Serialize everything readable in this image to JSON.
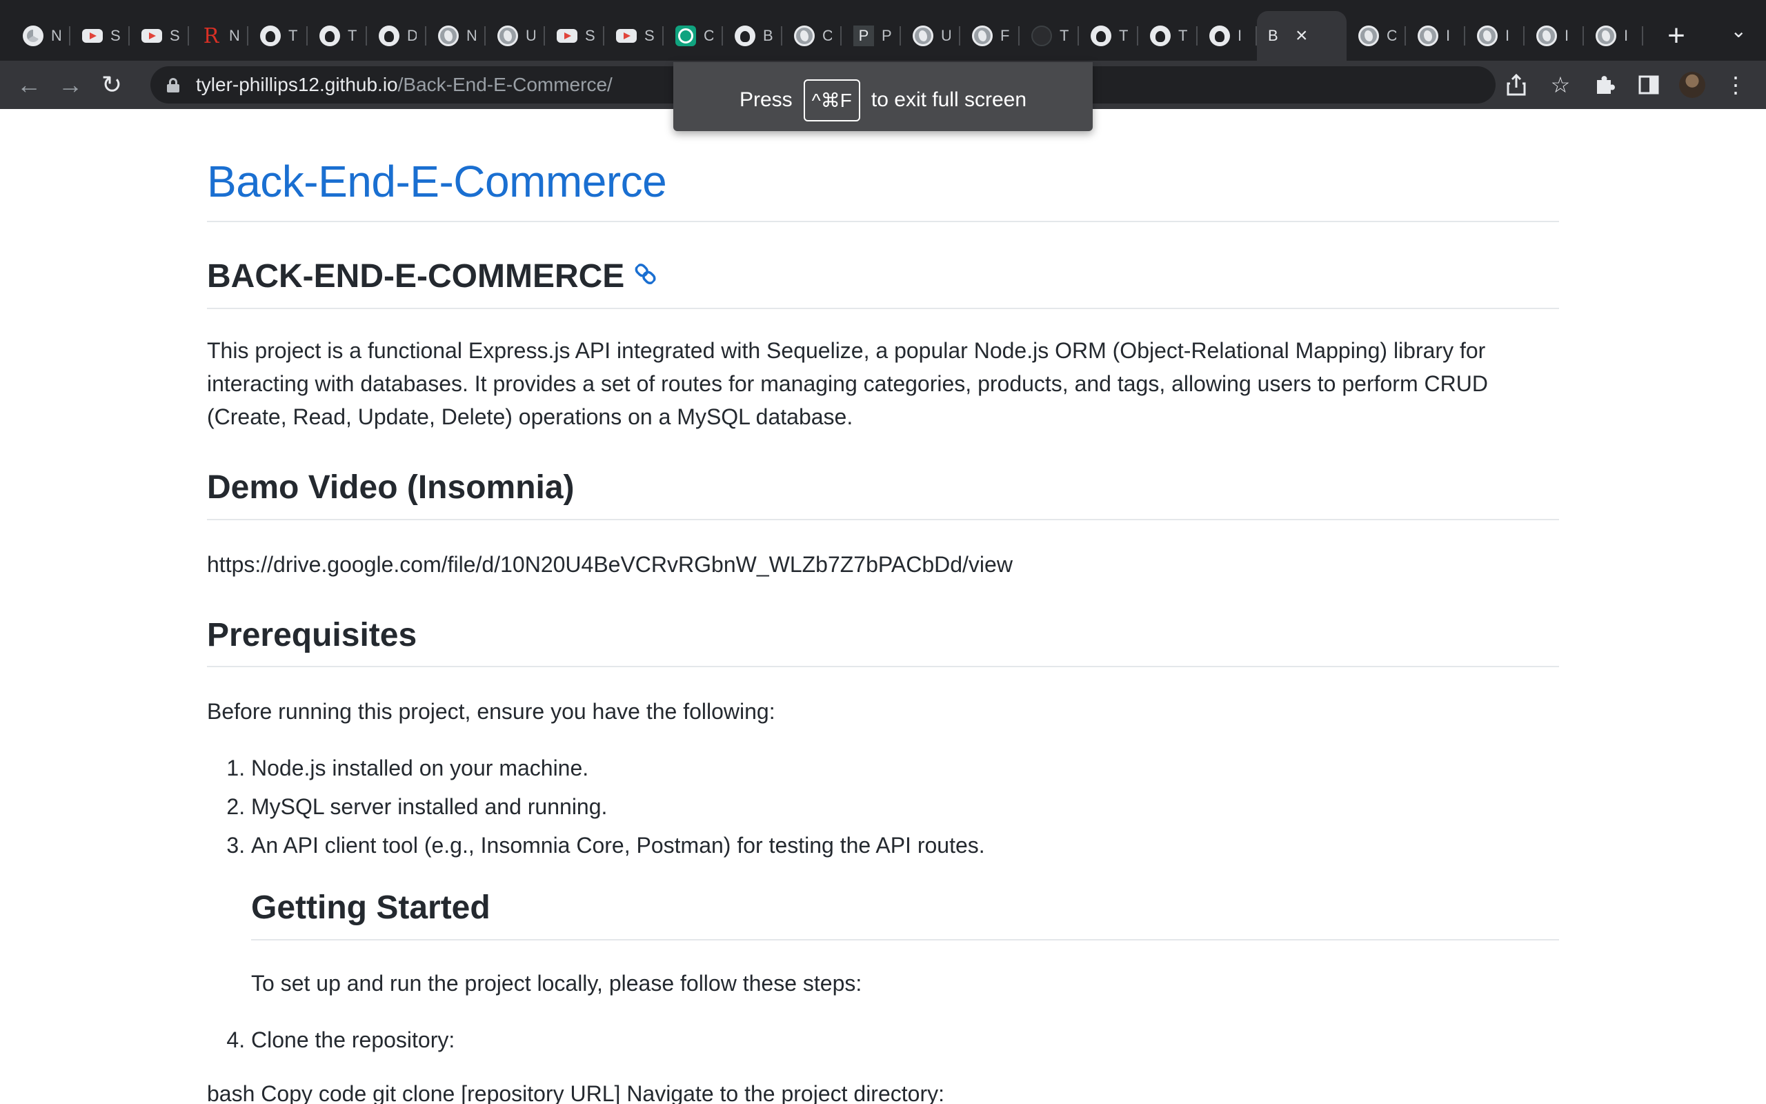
{
  "browser": {
    "tabs": [
      {
        "favicon": "chrome-icon",
        "title": "N"
      },
      {
        "favicon": "youtube-icon",
        "title": "S"
      },
      {
        "favicon": "youtube-icon",
        "title": "S"
      },
      {
        "favicon": "r-icon",
        "title": "N"
      },
      {
        "favicon": "github-icon",
        "title": "T"
      },
      {
        "favicon": "github-icon",
        "title": "T"
      },
      {
        "favicon": "github-icon",
        "title": "D"
      },
      {
        "favicon": "globe-icon",
        "title": "N"
      },
      {
        "favicon": "globe-icon",
        "title": "U"
      },
      {
        "favicon": "youtube-icon",
        "title": "S"
      },
      {
        "favicon": "youtube-icon",
        "title": "S"
      },
      {
        "favicon": "chatgpt-icon",
        "title": "C"
      },
      {
        "favicon": "github-icon",
        "title": "B"
      },
      {
        "favicon": "globe-icon",
        "title": "C"
      },
      {
        "favicon": "p-icon",
        "title": "P"
      },
      {
        "favicon": "globe-icon",
        "title": "U"
      },
      {
        "favicon": "globe-icon",
        "title": "F"
      },
      {
        "favicon": "dark-icon",
        "title": "T"
      },
      {
        "favicon": "github-icon",
        "title": "T"
      },
      {
        "favicon": "github-icon",
        "title": "T"
      },
      {
        "favicon": "github-icon",
        "title": "I"
      },
      {
        "favicon": "none",
        "title": "B",
        "active": true
      },
      {
        "favicon": "globe-icon",
        "title": "C"
      },
      {
        "favicon": "globe-icon",
        "title": "I"
      },
      {
        "favicon": "globe-icon",
        "title": "I"
      },
      {
        "favicon": "globe-icon",
        "title": "I"
      },
      {
        "favicon": "globe-icon",
        "title": "I"
      }
    ],
    "url_host": "tyler-phillips12.github.io",
    "url_path": "/Back-End-E-Commerce/",
    "fullscreen_notice": {
      "press": "Press",
      "shortcut": "^⌘F",
      "suffix": "to exit full screen"
    }
  },
  "page": {
    "site_title": "Back-End-E-Commerce",
    "heading": "BACK-END-E-COMMERCE",
    "description": "This project is a functional Express.js API integrated with Sequelize, a popular Node.js ORM (Object-Relational Mapping) library for interacting with databases. It provides a set of routes for managing categories, products, and tags, allowing users to perform CRUD (Create, Read, Update, Delete) operations on a MySQL database.",
    "demo_heading": "Demo Video (Insomnia)",
    "demo_link": "https://drive.google.com/file/d/10N20U4BeVCRvRGbnW_WLZb7Z7bPACbDd/view",
    "prereq_heading": "Prerequisites",
    "prereq_intro": "Before running this project, ensure you have the following:",
    "prereq_items": [
      "Node.js installed on your machine.",
      "MySQL server installed and running.",
      "An API client tool (e.g., Insomnia Core, Postman) for testing the API routes."
    ],
    "getting_started_heading": "Getting Started",
    "getting_started_text": "To set up and run the project locally, please follow these steps:",
    "step4": "Clone the repository:",
    "bash_line": "bash Copy code git clone [repository URL] Navigate to the project directory:"
  },
  "colors": {
    "link_blue": "#1a6fd1",
    "text": "#24292f",
    "chrome_dark": "#202124",
    "toolbar": "#35363a"
  }
}
